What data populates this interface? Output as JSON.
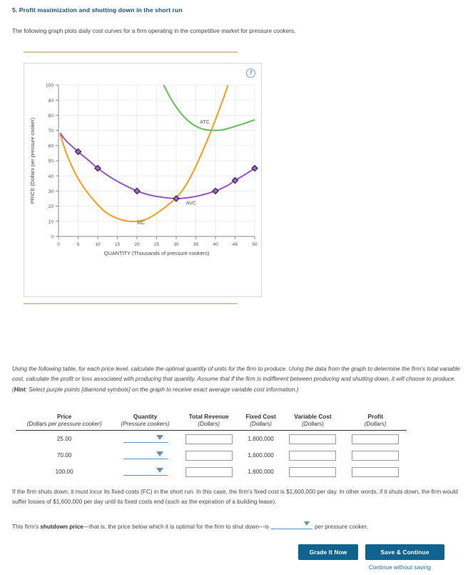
{
  "question": {
    "number_title": "5. Profit maximization and shutting down in the short run",
    "intro": "The following graph plots daily cost curves for a firm operating in the competitive market for pressure cookers."
  },
  "graph_panel": {
    "help_icon": "question-mark-icon"
  },
  "chart_data": {
    "type": "line",
    "title": "",
    "xlabel": "QUANTITY (Thousands of pressure cookers)",
    "ylabel": "PRICE (Dollars per pressure cooker)",
    "xlim": [
      0,
      50
    ],
    "ylim": [
      0,
      100
    ],
    "xticks": [
      0,
      5,
      10,
      15,
      20,
      25,
      30,
      35,
      40,
      45,
      50
    ],
    "yticks": [
      0,
      10,
      20,
      30,
      40,
      50,
      60,
      70,
      80,
      90,
      100
    ],
    "grid": true,
    "legend": "inline-labels",
    "series": [
      {
        "name": "MC",
        "label": "MC",
        "color": "#f5a01e",
        "label_x": 20,
        "label_y": 8,
        "points": [
          {
            "x": 0.5,
            "y": 67
          },
          {
            "x": 2,
            "y": 55
          },
          {
            "x": 4,
            "y": 43
          },
          {
            "x": 6,
            "y": 34
          },
          {
            "x": 8,
            "y": 27
          },
          {
            "x": 10,
            "y": 21
          },
          {
            "x": 12,
            "y": 16
          },
          {
            "x": 14,
            "y": 13
          },
          {
            "x": 16,
            "y": 11
          },
          {
            "x": 18,
            "y": 10
          },
          {
            "x": 20,
            "y": 10
          },
          {
            "x": 22,
            "y": 11
          },
          {
            "x": 24,
            "y": 13.5
          },
          {
            "x": 26,
            "y": 17
          },
          {
            "x": 28,
            "y": 21
          },
          {
            "x": 30,
            "y": 25.5
          },
          {
            "x": 32,
            "y": 32
          },
          {
            "x": 34,
            "y": 41
          },
          {
            "x": 36,
            "y": 52
          },
          {
            "x": 38,
            "y": 64
          },
          {
            "x": 40,
            "y": 77
          },
          {
            "x": 42,
            "y": 91
          },
          {
            "x": 43.2,
            "y": 100
          }
        ]
      },
      {
        "name": "ATC",
        "label": "ATC",
        "color": "#6cbf5e",
        "label_x": 36,
        "label_y": 74.5,
        "points": [
          {
            "x": 26.8,
            "y": 100
          },
          {
            "x": 28,
            "y": 94
          },
          {
            "x": 29,
            "y": 89.5
          },
          {
            "x": 30,
            "y": 85.5
          },
          {
            "x": 31,
            "y": 82
          },
          {
            "x": 32,
            "y": 79
          },
          {
            "x": 33,
            "y": 76.5
          },
          {
            "x": 34,
            "y": 74.4
          },
          {
            "x": 35,
            "y": 72.8
          },
          {
            "x": 36,
            "y": 71.6
          },
          {
            "x": 37,
            "y": 70.8
          },
          {
            "x": 38,
            "y": 70.3
          },
          {
            "x": 39,
            "y": 70.05
          },
          {
            "x": 40,
            "y": 70
          },
          {
            "x": 41,
            "y": 70.1
          },
          {
            "x": 42,
            "y": 70.5
          },
          {
            "x": 43,
            "y": 71.1
          },
          {
            "x": 44,
            "y": 71.9
          },
          {
            "x": 45,
            "y": 72.7
          },
          {
            "x": 46,
            "y": 73.5
          },
          {
            "x": 47,
            "y": 74.3
          },
          {
            "x": 48,
            "y": 75.2
          },
          {
            "x": 49,
            "y": 76.1
          },
          {
            "x": 50,
            "y": 77
          }
        ]
      },
      {
        "name": "AVC",
        "label": "AVC",
        "color": "#9b58c8",
        "label_x": 32.5,
        "label_y": 21,
        "points": [
          {
            "x": 0.5,
            "y": 68
          },
          {
            "x": 2,
            "y": 63
          },
          {
            "x": 5,
            "y": 56
          },
          {
            "x": 8,
            "y": 49.5
          },
          {
            "x": 10,
            "y": 45
          },
          {
            "x": 13,
            "y": 39.5
          },
          {
            "x": 16,
            "y": 35
          },
          {
            "x": 20,
            "y": 30
          },
          {
            "x": 23,
            "y": 27.5
          },
          {
            "x": 26,
            "y": 26
          },
          {
            "x": 30,
            "y": 25
          },
          {
            "x": 33,
            "y": 25.6
          },
          {
            "x": 36,
            "y": 27
          },
          {
            "x": 40,
            "y": 30
          },
          {
            "x": 43,
            "y": 33.5
          },
          {
            "x": 45,
            "y": 37
          },
          {
            "x": 47.5,
            "y": 40.8
          },
          {
            "x": 50,
            "y": 45
          }
        ],
        "markers": [
          {
            "x": 5,
            "y": 56
          },
          {
            "x": 10,
            "y": 45
          },
          {
            "x": 20,
            "y": 30
          },
          {
            "x": 30,
            "y": 25
          },
          {
            "x": 40,
            "y": 30
          },
          {
            "x": 45,
            "y": 37
          },
          {
            "x": 50,
            "y": 45
          }
        ],
        "marker_style": "diamond",
        "marker_color": "#a05fd0"
      }
    ]
  },
  "table_instructions": "Using the following table, for each price level, calculate the optimal quantity of units for the firm to produce. Using the data from the graph to determine the firm's total variable cost, calculate the profit or loss associated with producing that quantity. Assume that if the firm is indifferent between producing and shutting down, it will choose to produce. (Hint: Select purple points [diamond symbols] on the graph to receive exact average variable cost information.)",
  "table_instructions_parts": {
    "p1": "Using the following table, for each price level, calculate the optimal quantity of units for the firm to produce. Using the data from the graph to determine the firm's total variable cost, calculate the profit or loss associated with producing that quantity. Assume that if the firm is indifferent between producing and shutting down, it will choose to produce. (",
    "hint_label": "Hint",
    "p2": ": Select purple points [diamond symbols] on the graph to receive exact average variable cost information.)"
  },
  "cost_table": {
    "headers": [
      "Price",
      "Quantity",
      "Total Revenue",
      "Fixed Cost",
      "Variable Cost",
      "Profit"
    ],
    "subheaders": [
      "(Dollars per pressure cooker)",
      "(Pressure cookers)",
      "(Dollars)",
      "(Dollars)",
      "(Dollars)",
      "(Dollars)"
    ],
    "rows": [
      {
        "price": "25.00",
        "quantity": "",
        "total_revenue": "",
        "fixed_cost": "1,600,000",
        "variable_cost": "",
        "profit": ""
      },
      {
        "price": "70.00",
        "quantity": "",
        "total_revenue": "",
        "fixed_cost": "1,600,000",
        "variable_cost": "",
        "profit": ""
      },
      {
        "price": "100.00",
        "quantity": "",
        "total_revenue": "",
        "fixed_cost": "1,600,000",
        "variable_cost": "",
        "profit": ""
      }
    ]
  },
  "shutdown_paragraph": "If the firm shuts down, it must incur its fixed costs (FC) in the short run. In this case, the firm's fixed cost is $1,600,000 per day. In other words, if it shuts down, the firm would suffer losses of $1,600,000 per day until its fixed costs end (such as the expiration of a building lease).",
  "shutdown_question": {
    "p1": "This firm's ",
    "bold": "shutdown price",
    "p2": "—that is, the price below which it is optimal for the firm to shut down—is",
    "dropdown_value": "",
    "p3": "per pressure cooker."
  },
  "footer": {
    "grade_label": "Grade It Now",
    "save_label": "Save & Continue",
    "continue_link": "Continue without saving"
  },
  "colors": {
    "title_blue": "#1b4f7e",
    "button_blue": "#10628f",
    "link_blue": "#1a6ea8",
    "divider_tan": "#d9c99a",
    "mc_orange": "#f5a01e",
    "atc_green": "#6cbf5e",
    "avc_purple": "#9b58c8"
  }
}
